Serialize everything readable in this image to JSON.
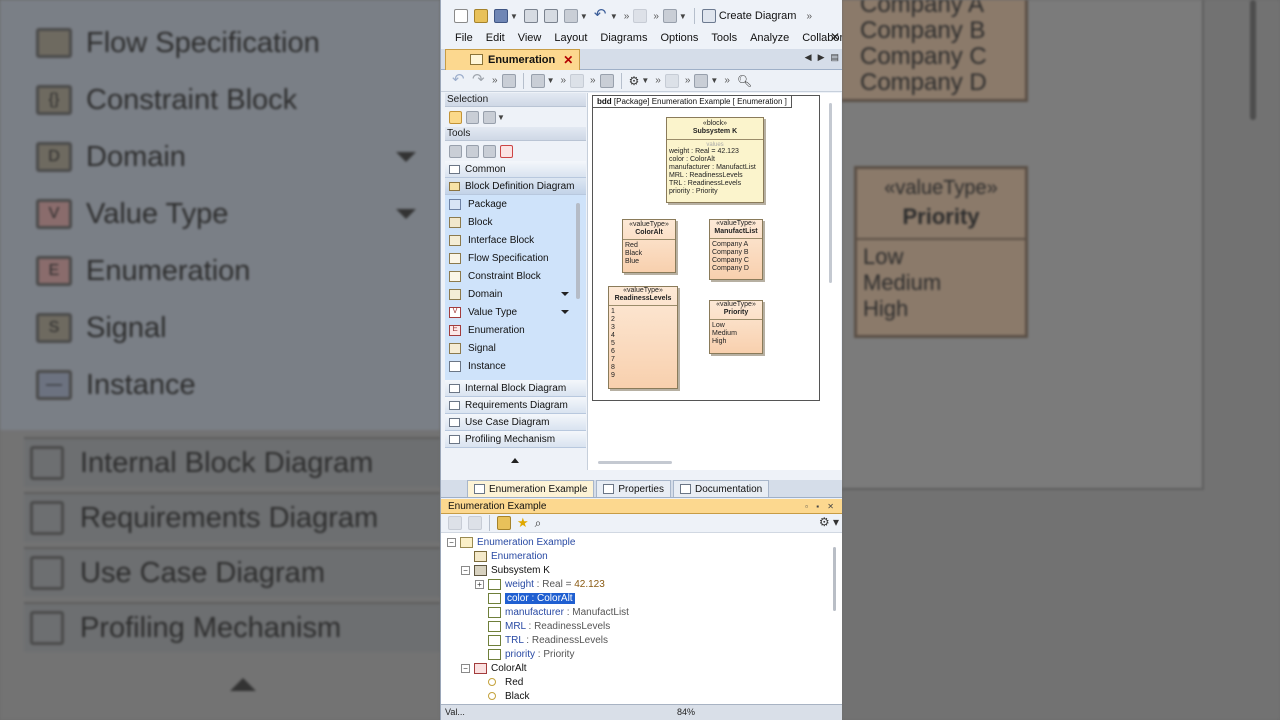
{
  "background_left": {
    "items": [
      {
        "label": "Flow Specification",
        "glyph": ""
      },
      {
        "label": "Constraint Block",
        "glyph": "{}"
      },
      {
        "label": "Domain",
        "glyph": "D"
      },
      {
        "label": "Value Type",
        "glyph": "V"
      },
      {
        "label": "Enumeration",
        "glyph": "E"
      },
      {
        "label": "Signal",
        "glyph": "S"
      },
      {
        "label": "Instance",
        "glyph": "—"
      }
    ],
    "diagrams": [
      "Internal Block Diagram",
      "Requirements Diagram",
      "Use Case Diagram",
      "Profiling Mechanism"
    ]
  },
  "background_right": {
    "companies": [
      "Company A",
      "Company B",
      "Company C",
      "Company D"
    ],
    "priority_stereotype": "«valueType»",
    "priority_name": "Priority",
    "priority_literals": [
      "Low",
      "Medium",
      "High"
    ]
  },
  "toolbar": {
    "create_diagram_label": "Create Diagram"
  },
  "menu": {
    "items": [
      "File",
      "Edit",
      "View",
      "Layout",
      "Diagrams",
      "Options",
      "Tools",
      "Analyze",
      "Collaborate"
    ],
    "close_glyph": "✕"
  },
  "diagram_tab": {
    "label": "Enumeration",
    "close_glyph": "✕"
  },
  "palette": {
    "selection_header": "Selection",
    "tools_header": "Tools",
    "groups_top": [
      "Common",
      "Block Definition Diagram"
    ],
    "items": [
      {
        "label": "Package",
        "icon": "package-icon",
        "cls": "pkg",
        "glyph": "",
        "dropdown": false
      },
      {
        "label": "Block",
        "icon": "block-icon",
        "cls": "blk",
        "glyph": "",
        "dropdown": false
      },
      {
        "label": "Interface Block",
        "icon": "interface-block-icon",
        "cls": "ifb",
        "glyph": "",
        "dropdown": false
      },
      {
        "label": "Flow Specification",
        "icon": "flow-specification-icon",
        "cls": "flow",
        "glyph": "",
        "dropdown": false
      },
      {
        "label": "Constraint Block",
        "icon": "constraint-block-icon",
        "cls": "con",
        "glyph": "",
        "dropdown": false
      },
      {
        "label": "Domain",
        "icon": "domain-icon",
        "cls": "dom",
        "glyph": "",
        "dropdown": true
      },
      {
        "label": "Value Type",
        "icon": "value-type-icon",
        "cls": "val",
        "glyph": "V",
        "dropdown": true
      },
      {
        "label": "Enumeration",
        "icon": "enumeration-icon",
        "cls": "enm",
        "glyph": "E",
        "dropdown": false
      },
      {
        "label": "Signal",
        "icon": "signal-icon",
        "cls": "sig",
        "glyph": "",
        "dropdown": false
      },
      {
        "label": "Instance",
        "icon": "instance-icon",
        "cls": "ins",
        "glyph": "",
        "dropdown": false
      }
    ],
    "groups_bottom": [
      "Internal Block Diagram",
      "Requirements Diagram",
      "Use Case Diagram",
      "Profiling Mechanism"
    ]
  },
  "diagram": {
    "frame_kind": "bdd",
    "frame_label": "[Package] Enumeration Example [ Enumeration ]",
    "block": {
      "stereotype": "«block»",
      "name": "Subsystem K",
      "compartment": "values",
      "values": [
        "weight : Real = 42.123",
        "color : ColorAlt",
        "manufacturer : ManufactList",
        "MRL : ReadinessLevels",
        "TRL : ReadinessLevels",
        "priority : Priority"
      ]
    },
    "value_types": [
      {
        "id": "color",
        "stereotype": "«valueType»",
        "name": "ColorAlt",
        "literals": [
          "Red",
          "Black",
          "Blue"
        ]
      },
      {
        "id": "manuf",
        "stereotype": "«valueType»",
        "name": "ManufactList",
        "literals": [
          "Company A",
          "Company B",
          "Company C",
          "Company D"
        ]
      },
      {
        "id": "rl",
        "stereotype": "«valueType»",
        "name": "ReadinessLevels",
        "literals": [
          "1",
          "2",
          "3",
          "4",
          "5",
          "6",
          "7",
          "8",
          "9"
        ]
      },
      {
        "id": "prio",
        "stereotype": "«valueType»",
        "name": "Priority",
        "literals": [
          "Low",
          "Medium",
          "High"
        ]
      }
    ]
  },
  "lower_tabs": [
    "Enumeration Example",
    "Properties",
    "Documentation"
  ],
  "tree": {
    "header": "Enumeration Example",
    "nodes": [
      {
        "depth": 0,
        "toggle": "−",
        "icon": "folderi",
        "parts": [
          [
            "Enumeration Example",
            "tn-blue"
          ]
        ],
        "sel": false
      },
      {
        "depth": 1,
        "toggle": "",
        "icon": "diagi",
        "parts": [
          [
            "Enumeration",
            "tn-blue"
          ]
        ],
        "sel": false
      },
      {
        "depth": 1,
        "toggle": "−",
        "icon": "blki",
        "parts": [
          [
            "Subsystem K",
            "tn-black"
          ]
        ],
        "sel": false
      },
      {
        "depth": 2,
        "toggle": "+",
        "icon": "propi",
        "parts": [
          [
            "weight",
            "tn-blue"
          ],
          [
            " : Real = ",
            "tn-gray"
          ],
          [
            "42.123",
            "tn-brown"
          ]
        ],
        "sel": false
      },
      {
        "depth": 2,
        "toggle": "",
        "icon": "propi",
        "parts": [
          [
            "color : ColorAlt",
            "tn-black"
          ]
        ],
        "sel": true
      },
      {
        "depth": 2,
        "toggle": "",
        "icon": "propi",
        "parts": [
          [
            "manufacturer",
            "tn-blue"
          ],
          [
            " : ManufactList",
            "tn-gray"
          ]
        ],
        "sel": false
      },
      {
        "depth": 2,
        "toggle": "",
        "icon": "propi",
        "parts": [
          [
            "MRL",
            "tn-blue"
          ],
          [
            " : ReadinessLevels",
            "tn-gray"
          ]
        ],
        "sel": false
      },
      {
        "depth": 2,
        "toggle": "",
        "icon": "propi",
        "parts": [
          [
            "TRL",
            "tn-blue"
          ],
          [
            " : ReadinessLevels",
            "tn-gray"
          ]
        ],
        "sel": false
      },
      {
        "depth": 2,
        "toggle": "",
        "icon": "propi",
        "parts": [
          [
            "priority",
            "tn-blue"
          ],
          [
            " : Priority",
            "tn-gray"
          ]
        ],
        "sel": false
      },
      {
        "depth": 1,
        "toggle": "−",
        "icon": "enumi",
        "parts": [
          [
            "ColorAlt",
            "tn-black"
          ]
        ],
        "sel": false
      },
      {
        "depth": 2,
        "toggle": "",
        "icon": "liti",
        "parts": [
          [
            "Red",
            "tn-black"
          ]
        ],
        "sel": false
      },
      {
        "depth": 2,
        "toggle": "",
        "icon": "liti",
        "parts": [
          [
            "Black",
            "tn-black"
          ]
        ],
        "sel": false
      }
    ]
  },
  "status": {
    "left": "Val...",
    "zoom": "84%"
  },
  "colors": {
    "tab_active": "#fcd88f",
    "selection": "#1f5fd1",
    "palette_bg": "#cfe3fa",
    "block_fill": "#fbf4cc",
    "valuetype_fill": "#f8d0ae"
  }
}
